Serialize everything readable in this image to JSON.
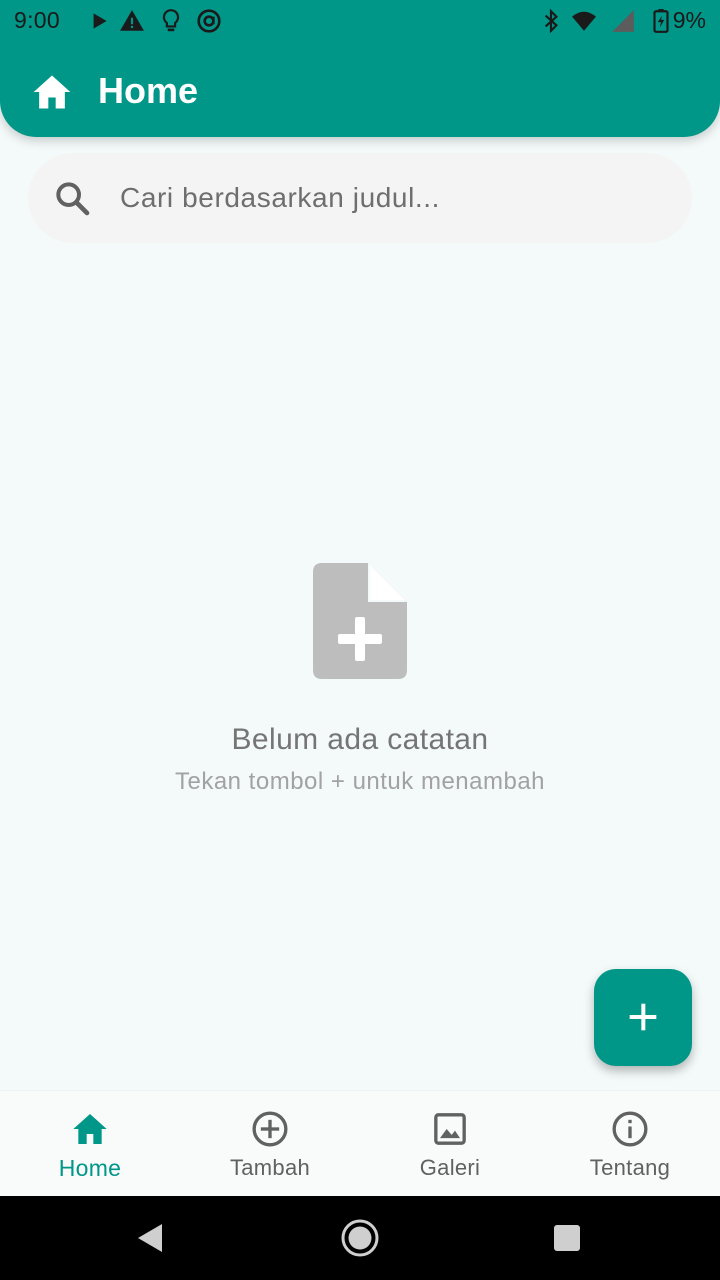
{
  "status_bar": {
    "time": "9:00",
    "battery_percent": "9%",
    "icons": [
      "play-icon",
      "alert-icon",
      "bulb-icon",
      "at-icon",
      "bluetooth-icon",
      "wifi-icon",
      "signal-icon",
      "battery-icon"
    ]
  },
  "app_bar": {
    "title": "Home",
    "icon": "home-icon"
  },
  "search": {
    "placeholder": "Cari berdasarkan judul..."
  },
  "empty_state": {
    "icon": "note-add-icon",
    "title": "Belum ada catatan",
    "subtitle": "Tekan tombol + untuk menambah"
  },
  "fab": {
    "icon": "plus-icon"
  },
  "bottom_nav": {
    "items": [
      {
        "label": "Home",
        "icon": "home-icon",
        "active": true
      },
      {
        "label": "Tambah",
        "icon": "add-circle-icon",
        "active": false
      },
      {
        "label": "Galeri",
        "icon": "image-icon",
        "active": false
      },
      {
        "label": "Tentang",
        "icon": "info-icon",
        "active": false
      }
    ]
  },
  "colors": {
    "primary": "#009688",
    "background": "#f3faf9",
    "search_bg": "#f4f4f4",
    "empty_icon": "#bdbdbd"
  }
}
